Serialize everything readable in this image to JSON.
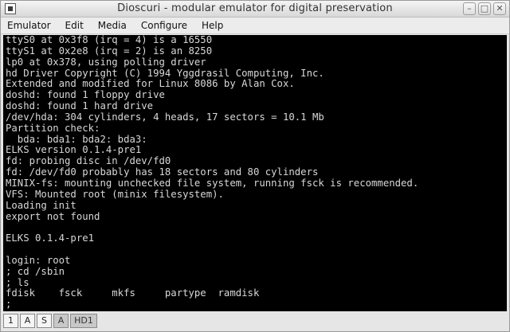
{
  "window": {
    "title": "Dioscuri - modular emulator for digital preservation",
    "buttons": [
      "–",
      "□",
      "✕"
    ]
  },
  "menu": [
    "Emulator",
    "Edit",
    "Media",
    "Configure",
    "Help"
  ],
  "console": {
    "lines": [
      "ttyS0 at 0x3f8 (irq = 4) is a 16550",
      "ttyS1 at 0x2e8 (irq = 2) is an 8250",
      "lp0 at 0x378, using polling driver",
      "hd Driver Copyright (C) 1994 Yggdrasil Computing, Inc.",
      "Extended and modified for Linux 8086 by Alan Cox.",
      "doshd: found 1 floppy drive",
      "doshd: found 1 hard drive",
      "/dev/hda: 304 cylinders, 4 heads, 17 sectors = 10.1 Mb",
      "Partition check:",
      "  bda: bda1: bda2: bda3:",
      "ELKS version 0.1.4-pre1",
      "fd: probing disc in /dev/fd0",
      "fd: /dev/fd0 probably has 18 sectors and 80 cylinders",
      "MINIX-fs: mounting unchecked file system, running fsck is recommended.",
      "VFS: Mounted root (minix filesystem).",
      "Loading init",
      "export not found",
      "",
      "ELKS 0.1.4-pre1",
      "",
      "login: root",
      "; cd /sbin",
      "; ls",
      "fdisk    fsck     mkfs     partype  ramdisk",
      ";"
    ]
  },
  "status": {
    "indicators": [
      {
        "label": "1",
        "state": "on"
      },
      {
        "label": "A",
        "state": "on"
      },
      {
        "label": "S",
        "state": "on"
      },
      {
        "label": "A",
        "state": "off"
      },
      {
        "label": "HD1",
        "state": "off"
      }
    ]
  }
}
